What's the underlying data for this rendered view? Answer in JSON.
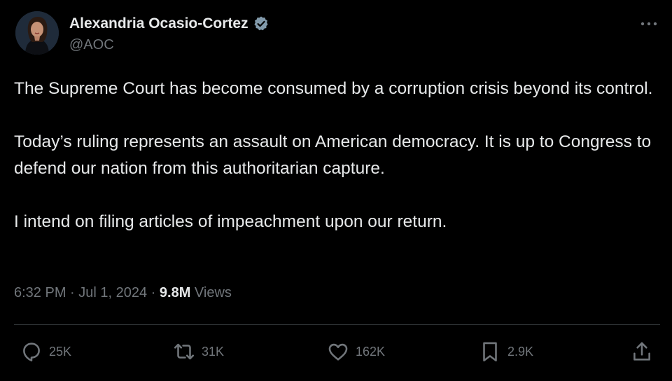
{
  "author": {
    "display_name": "Alexandria Ocasio-Cortez",
    "handle": "@AOC",
    "verified": true,
    "avatar_icon": "avatar-photo"
  },
  "tweet": {
    "paragraphs": [
      "The Supreme Court has become consumed by a corruption crisis beyond its control.",
      "Today’s ruling represents an assault on American democracy. It is up to Congress to defend our nation from this authoritarian capture.",
      "I intend on filing articles of impeachment upon our return."
    ],
    "time": "6:32 PM",
    "sep1": " · ",
    "date": "Jul 1, 2024",
    "sep2": " · ",
    "views_count": "9.8M",
    "views_label": " Views"
  },
  "actions": {
    "replies": "25K",
    "reposts": "31K",
    "likes": "162K",
    "bookmarks": "2.9K"
  },
  "icons": {
    "more": "more-dots-icon",
    "reply": "reply-icon",
    "repost": "repost-icon",
    "like": "heart-icon",
    "bookmark": "bookmark-icon",
    "share": "share-icon",
    "verified": "verified-badge-icon"
  },
  "colors": {
    "background": "#000000",
    "text": "#e7e9ea",
    "secondary": "#71767b",
    "divider": "#2f3336",
    "verified_badge": "#829aab"
  }
}
